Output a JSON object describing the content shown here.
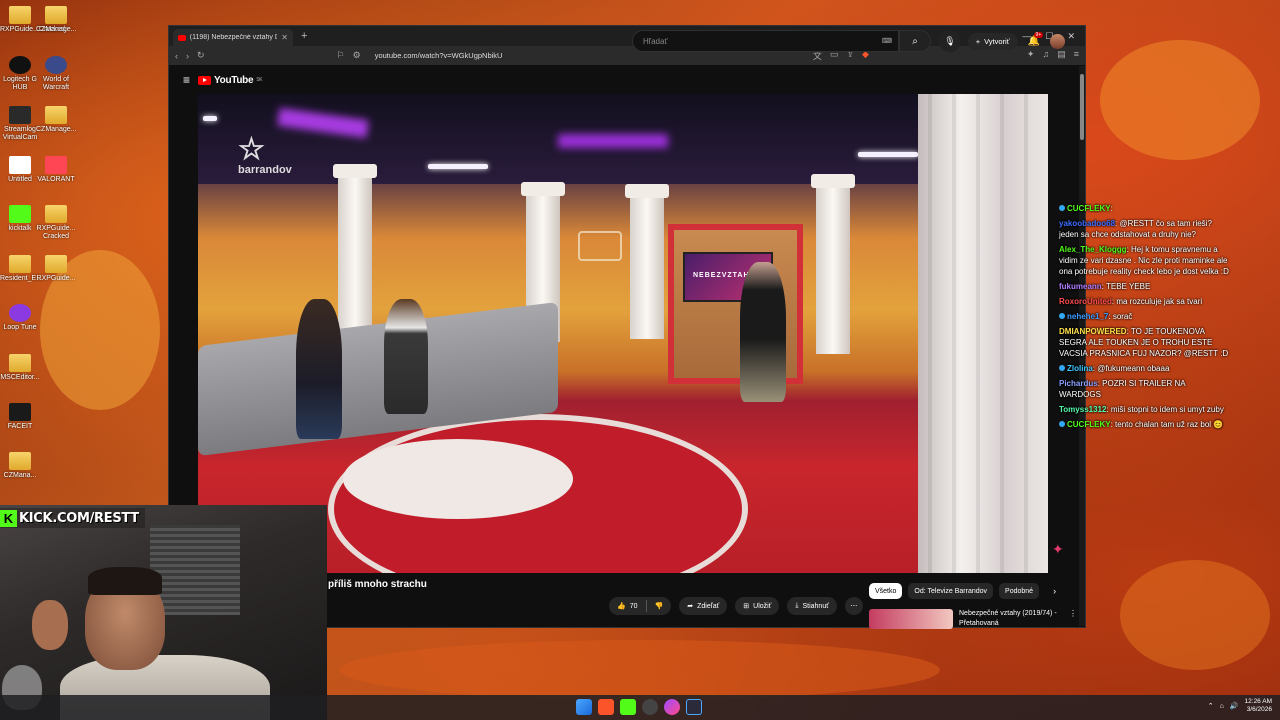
{
  "desktop": {
    "icons": [
      {
        "label": "RXPGuide...Cracked"
      },
      {
        "label": "CZManage..."
      },
      {
        "label": "Logitech G HUB"
      },
      {
        "label": "World of Warcraft"
      },
      {
        "label": "Streamlog VirtualCam"
      },
      {
        "label": "CZManage..."
      },
      {
        "label": "Untitled"
      },
      {
        "label": "VALORANT"
      },
      {
        "label": "kicktalk"
      },
      {
        "label": "RXPGuide... Cracked"
      },
      {
        "label": "Resident_E..."
      },
      {
        "label": "RXPGuide..."
      },
      {
        "label": "Loop Tune"
      },
      {
        "label": "MSCEditor..."
      },
      {
        "label": "FACEIT"
      },
      {
        "label": "CZMana..."
      }
    ]
  },
  "browser": {
    "tab_title": "(1198) Nebezpečné vztahy D",
    "url": "youtube.com/watch?v=WGkUgpNbikU"
  },
  "youtube": {
    "logo_text": "YouTube",
    "logo_country": "SK",
    "search_placeholder": "Hľadať",
    "create_label": "Vytvoriť",
    "notif_count": "9+",
    "video_title": "příliš mnoho strachu",
    "likes": "70",
    "share_label": "Zdieľať",
    "save_label": "Uložiť",
    "download_label": "Stiahnuť",
    "chips": [
      "Všetko",
      "Od: Televize Barrandov",
      "Podobné"
    ],
    "rec_title": "Nebezpečné vztahy (2019/74) - Přetahovaná",
    "watermark": "barrandov",
    "screen_text": "NEBEZVZTAHY"
  },
  "chat": [
    {
      "user": "CUCFLEKY",
      "color": "#53fc18",
      "badge": true,
      "text": ""
    },
    {
      "user": "yakoobadoo68",
      "color": "#3b6bff",
      "badge": false,
      "text": "@RESTT čo sa tam rieši? jeden sa chce odstahovat a druhy nie?"
    },
    {
      "user": "Alex_The_Kloggg",
      "color": "#53fc18",
      "badge": false,
      "text": "Hej k tomu spravnemu a vidim ze vari dzasne . Nic zle proti maminke ale ona potrebuje reality check lebo je dost velka :D"
    },
    {
      "user": "fukumeann",
      "color": "#b07cff",
      "badge": false,
      "text": "TEBE YEBE"
    },
    {
      "user": "RoxoroUnited",
      "color": "#ff4d4d",
      "badge": false,
      "text": "ma rozculuje jak sa tvari"
    },
    {
      "user": "nehehe1_7",
      "color": "#3b9bff",
      "badge": true,
      "text": "sorač"
    },
    {
      "user": "DMIANPOWERED",
      "color": "#ffe14a",
      "badge": false,
      "text": "TO JE TOUKENOVA SEGRA ALE TOUKEN JE O TROHU ESTE VACSIA PRASNICA FUJ NAZOR? @RESTT :D"
    },
    {
      "user": "Zlolina",
      "color": "#3bc8ff",
      "badge": true,
      "text": "@fukumeann obaaa"
    },
    {
      "user": "Pichardus",
      "color": "#8aa0ff",
      "badge": false,
      "text": "POZRI SI TRAILER NA WARDOGS"
    },
    {
      "user": "Tomyss1312",
      "color": "#53fcaa",
      "badge": false,
      "text": "miši stopni to idem si umyt zuby"
    },
    {
      "user": "CUCFLEKY",
      "color": "#53fc18",
      "badge": true,
      "text": "tento chalan tam už raz bol 😊"
    }
  ],
  "overlay": {
    "kick_url": "KICK.COM/RESTT"
  },
  "taskbar": {
    "time": "12:26 AM",
    "date": "3/6/2026"
  }
}
